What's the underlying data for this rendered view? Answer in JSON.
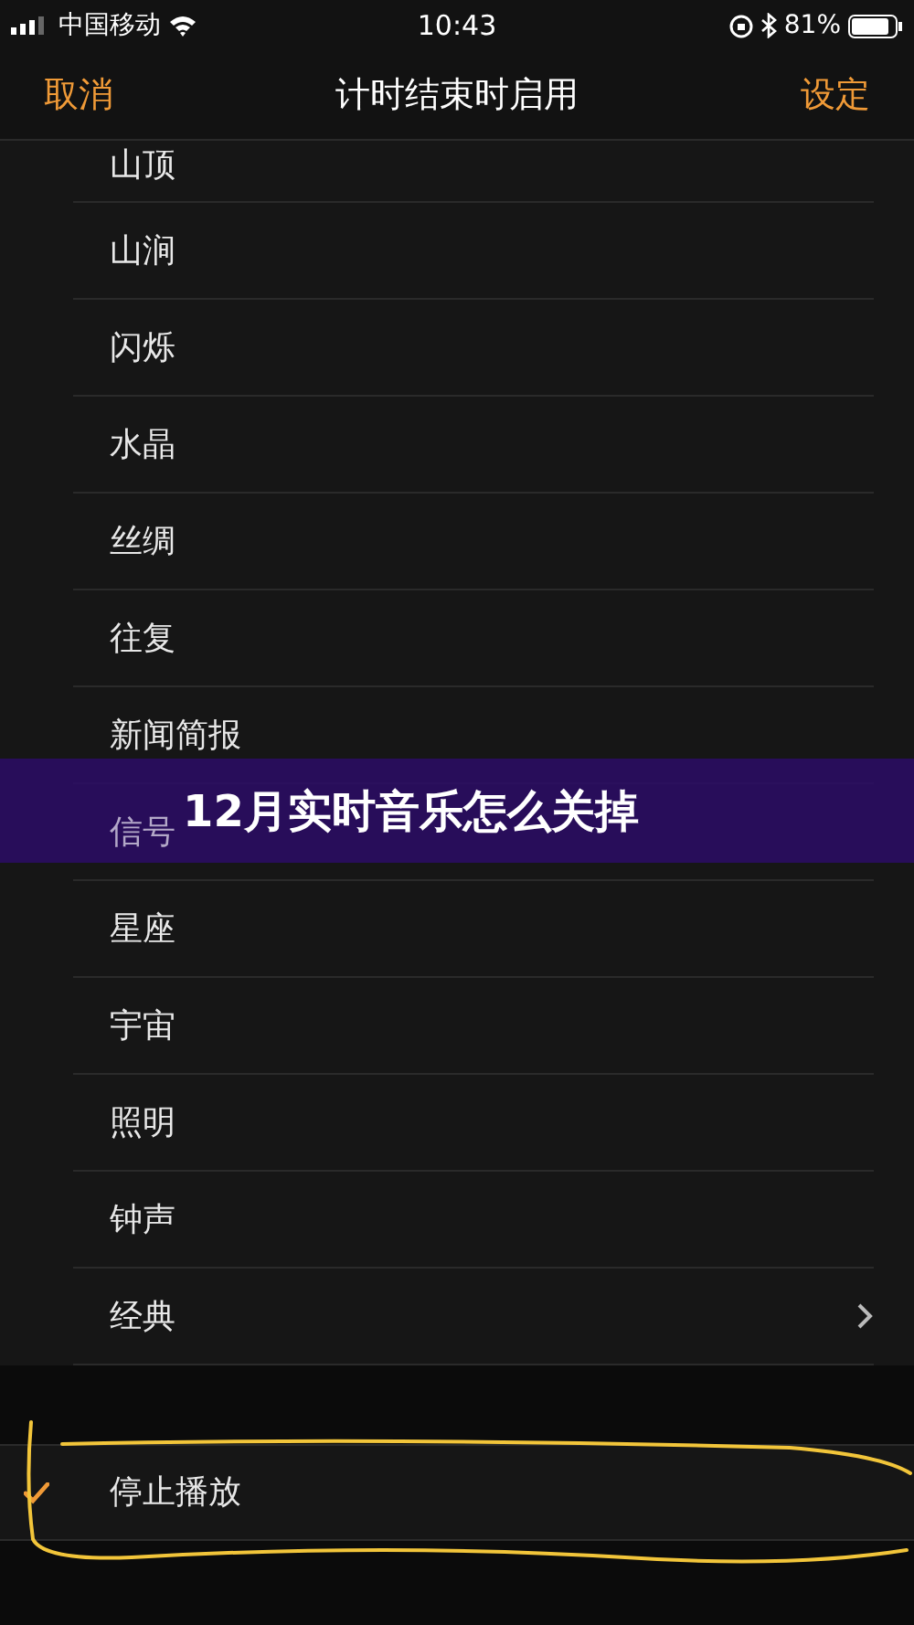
{
  "status_bar": {
    "carrier": "中国移动",
    "time": "10:43",
    "battery": "81%"
  },
  "nav": {
    "cancel": "取消",
    "title": "计时结束时启用",
    "confirm": "设定"
  },
  "sounds": [
    {
      "label": "山顶",
      "kind": "option",
      "selected": false
    },
    {
      "label": "山涧",
      "kind": "option",
      "selected": false
    },
    {
      "label": "闪烁",
      "kind": "option",
      "selected": false
    },
    {
      "label": "水晶",
      "kind": "option",
      "selected": false
    },
    {
      "label": "丝绸",
      "kind": "option",
      "selected": false
    },
    {
      "label": "往复",
      "kind": "option",
      "selected": false
    },
    {
      "label": "新闻简报",
      "kind": "option",
      "selected": false
    },
    {
      "label": "信号",
      "kind": "option",
      "selected": false
    },
    {
      "label": "星座",
      "kind": "option",
      "selected": false
    },
    {
      "label": "宇宙",
      "kind": "option",
      "selected": false
    },
    {
      "label": "照明",
      "kind": "option",
      "selected": false
    },
    {
      "label": "钟声",
      "kind": "option",
      "selected": false
    },
    {
      "label": "经典",
      "kind": "submenu",
      "selected": false
    }
  ],
  "stop_option": {
    "label": "停止播放",
    "selected": true
  },
  "banner": {
    "title": "12月实时音乐怎么关掉"
  }
}
